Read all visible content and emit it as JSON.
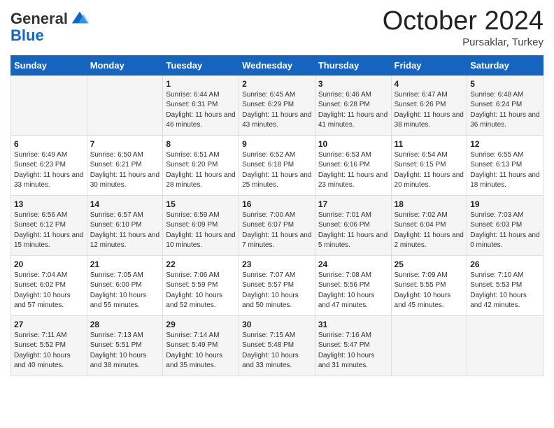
{
  "header": {
    "logo_general": "General",
    "logo_blue": "Blue",
    "month": "October 2024",
    "location": "Pursaklar, Turkey"
  },
  "days_of_week": [
    "Sunday",
    "Monday",
    "Tuesday",
    "Wednesday",
    "Thursday",
    "Friday",
    "Saturday"
  ],
  "weeks": [
    [
      {
        "day": "",
        "info": ""
      },
      {
        "day": "",
        "info": ""
      },
      {
        "day": "1",
        "info": "Sunrise: 6:44 AM\nSunset: 6:31 PM\nDaylight: 11 hours and 46 minutes."
      },
      {
        "day": "2",
        "info": "Sunrise: 6:45 AM\nSunset: 6:29 PM\nDaylight: 11 hours and 43 minutes."
      },
      {
        "day": "3",
        "info": "Sunrise: 6:46 AM\nSunset: 6:28 PM\nDaylight: 11 hours and 41 minutes."
      },
      {
        "day": "4",
        "info": "Sunrise: 6:47 AM\nSunset: 6:26 PM\nDaylight: 11 hours and 38 minutes."
      },
      {
        "day": "5",
        "info": "Sunrise: 6:48 AM\nSunset: 6:24 PM\nDaylight: 11 hours and 36 minutes."
      }
    ],
    [
      {
        "day": "6",
        "info": "Sunrise: 6:49 AM\nSunset: 6:23 PM\nDaylight: 11 hours and 33 minutes."
      },
      {
        "day": "7",
        "info": "Sunrise: 6:50 AM\nSunset: 6:21 PM\nDaylight: 11 hours and 30 minutes."
      },
      {
        "day": "8",
        "info": "Sunrise: 6:51 AM\nSunset: 6:20 PM\nDaylight: 11 hours and 28 minutes."
      },
      {
        "day": "9",
        "info": "Sunrise: 6:52 AM\nSunset: 6:18 PM\nDaylight: 11 hours and 25 minutes."
      },
      {
        "day": "10",
        "info": "Sunrise: 6:53 AM\nSunset: 6:16 PM\nDaylight: 11 hours and 23 minutes."
      },
      {
        "day": "11",
        "info": "Sunrise: 6:54 AM\nSunset: 6:15 PM\nDaylight: 11 hours and 20 minutes."
      },
      {
        "day": "12",
        "info": "Sunrise: 6:55 AM\nSunset: 6:13 PM\nDaylight: 11 hours and 18 minutes."
      }
    ],
    [
      {
        "day": "13",
        "info": "Sunrise: 6:56 AM\nSunset: 6:12 PM\nDaylight: 11 hours and 15 minutes."
      },
      {
        "day": "14",
        "info": "Sunrise: 6:57 AM\nSunset: 6:10 PM\nDaylight: 11 hours and 12 minutes."
      },
      {
        "day": "15",
        "info": "Sunrise: 6:59 AM\nSunset: 6:09 PM\nDaylight: 11 hours and 10 minutes."
      },
      {
        "day": "16",
        "info": "Sunrise: 7:00 AM\nSunset: 6:07 PM\nDaylight: 11 hours and 7 minutes."
      },
      {
        "day": "17",
        "info": "Sunrise: 7:01 AM\nSunset: 6:06 PM\nDaylight: 11 hours and 5 minutes."
      },
      {
        "day": "18",
        "info": "Sunrise: 7:02 AM\nSunset: 6:04 PM\nDaylight: 11 hours and 2 minutes."
      },
      {
        "day": "19",
        "info": "Sunrise: 7:03 AM\nSunset: 6:03 PM\nDaylight: 11 hours and 0 minutes."
      }
    ],
    [
      {
        "day": "20",
        "info": "Sunrise: 7:04 AM\nSunset: 6:02 PM\nDaylight: 10 hours and 57 minutes."
      },
      {
        "day": "21",
        "info": "Sunrise: 7:05 AM\nSunset: 6:00 PM\nDaylight: 10 hours and 55 minutes."
      },
      {
        "day": "22",
        "info": "Sunrise: 7:06 AM\nSunset: 5:59 PM\nDaylight: 10 hours and 52 minutes."
      },
      {
        "day": "23",
        "info": "Sunrise: 7:07 AM\nSunset: 5:57 PM\nDaylight: 10 hours and 50 minutes."
      },
      {
        "day": "24",
        "info": "Sunrise: 7:08 AM\nSunset: 5:56 PM\nDaylight: 10 hours and 47 minutes."
      },
      {
        "day": "25",
        "info": "Sunrise: 7:09 AM\nSunset: 5:55 PM\nDaylight: 10 hours and 45 minutes."
      },
      {
        "day": "26",
        "info": "Sunrise: 7:10 AM\nSunset: 5:53 PM\nDaylight: 10 hours and 42 minutes."
      }
    ],
    [
      {
        "day": "27",
        "info": "Sunrise: 7:11 AM\nSunset: 5:52 PM\nDaylight: 10 hours and 40 minutes."
      },
      {
        "day": "28",
        "info": "Sunrise: 7:13 AM\nSunset: 5:51 PM\nDaylight: 10 hours and 38 minutes."
      },
      {
        "day": "29",
        "info": "Sunrise: 7:14 AM\nSunset: 5:49 PM\nDaylight: 10 hours and 35 minutes."
      },
      {
        "day": "30",
        "info": "Sunrise: 7:15 AM\nSunset: 5:48 PM\nDaylight: 10 hours and 33 minutes."
      },
      {
        "day": "31",
        "info": "Sunrise: 7:16 AM\nSunset: 5:47 PM\nDaylight: 10 hours and 31 minutes."
      },
      {
        "day": "",
        "info": ""
      },
      {
        "day": "",
        "info": ""
      }
    ]
  ]
}
